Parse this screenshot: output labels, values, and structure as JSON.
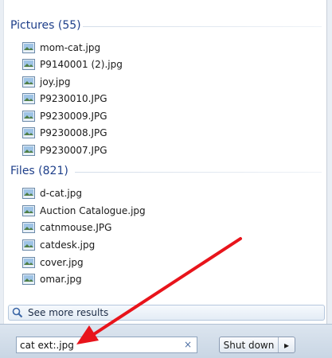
{
  "groups": [
    {
      "title": "Pictures (55)",
      "items": [
        "mom-cat.jpg",
        "P9140001 (2).jpg",
        "joy.jpg",
        "P9230010.JPG",
        "P9230009.JPG",
        "P9230008.JPG",
        "P9230007.JPG"
      ]
    },
    {
      "title": "Files (821)",
      "items": [
        "d-cat.jpg",
        "Auction Catalogue.jpg",
        "catnmouse.JPG",
        "catdesk.jpg",
        "cover.jpg",
        "omar.jpg"
      ]
    }
  ],
  "see_more": "See more results",
  "search": {
    "value": "cat ext:.jpg",
    "clear_glyph": "×"
  },
  "shutdown": {
    "label": "Shut down",
    "arrow_glyph": "▸"
  },
  "icons": {
    "file": "image-file-icon",
    "search": "magnifier-icon"
  },
  "colors": {
    "header_text": "#1e3f8a",
    "annotation_arrow": "#e8141b"
  }
}
